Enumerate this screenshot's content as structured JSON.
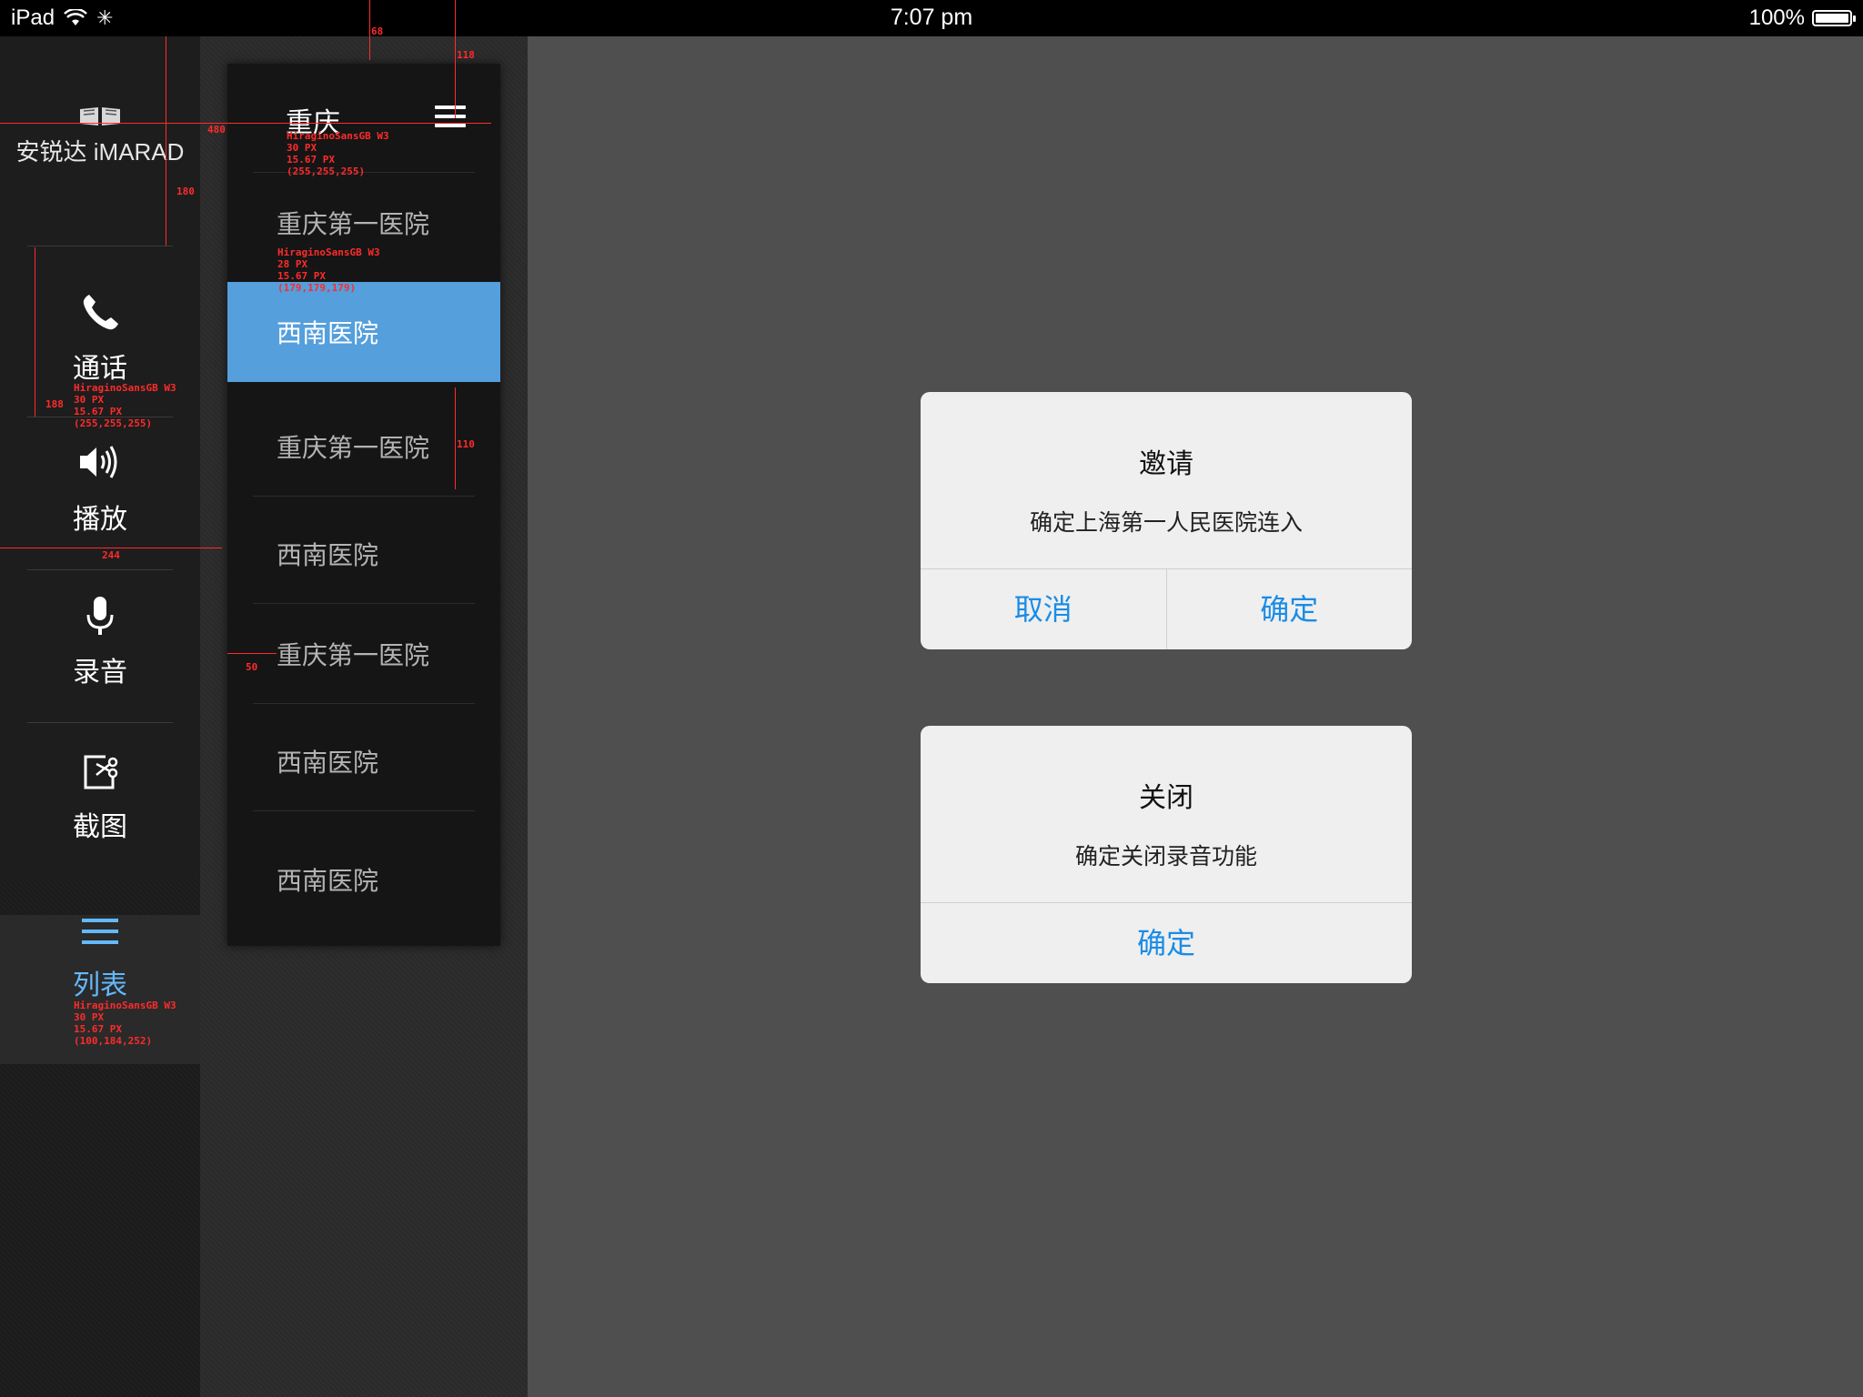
{
  "status_bar": {
    "device": "iPad",
    "time": "7:07 pm",
    "battery": "100%",
    "battery_level": 1.0
  },
  "sidebar": {
    "brand": "安锐达 iMARAD",
    "items": [
      {
        "label": "通话",
        "icon": "phone-icon"
      },
      {
        "label": "播放",
        "icon": "speaker-icon"
      },
      {
        "label": "录音",
        "icon": "microphone-icon"
      },
      {
        "label": "截图",
        "icon": "screenshot-icon"
      },
      {
        "label": "列表",
        "icon": "list-icon",
        "active": true
      }
    ]
  },
  "list_panel": {
    "title": "重庆",
    "rows": [
      "重庆第一医院",
      "西南医院",
      "重庆第一医院",
      "西南医院",
      "重庆第一医院",
      "西南医院",
      "西南医院"
    ],
    "selected_index": 1
  },
  "dialogs": {
    "invite": {
      "title": "邀请",
      "message": "确定上海第一人民医院连入",
      "cancel": "取消",
      "ok": "确定"
    },
    "close": {
      "title": "关闭",
      "message": "确定关闭录音功能",
      "ok": "确定"
    }
  },
  "annotations": {
    "title_spec": "HiraginoSansGB W3\n30 PX\n15.67 PX\n(255,255,255)",
    "row_spec": "HiraginoSansGB W3\n28 PX\n15.67 PX\n(179,179,179)",
    "nav_spec": "HiraginoSansGB W3\n30 PX\n15.67 PX\n(255,255,255)",
    "active_spec": "HiraginoSansGB W3\n30 PX\n15.67 PX\n(100,184,252)",
    "d68": "68",
    "d118": "118",
    "d480": "480",
    "d180": "180",
    "d188": "188",
    "d244": "244",
    "d110": "110",
    "d50": "50"
  },
  "colors": {
    "accent": "#549fdc",
    "active_label": "#64b8fc",
    "dialog_button": "#1a8ce6",
    "annotation": "#ff2b2b"
  }
}
